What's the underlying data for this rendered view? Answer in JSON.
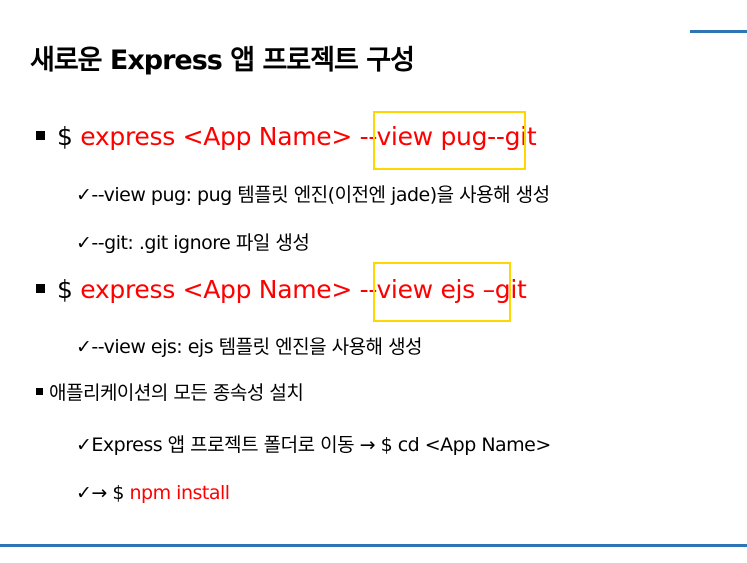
{
  "title": "새로운 Express 앱 프로젝트 구성",
  "bullets": [
    {
      "prompt": "$ ",
      "parts": [
        "express <App Name>",
        " ",
        "--view pug",
        "--git"
      ]
    },
    {
      "prompt": "$ ",
      "parts": [
        "express <App Name>",
        " ",
        "--view ejs",
        " –git"
      ]
    }
  ],
  "subs": [
    {
      "check": "✓",
      "text": "--view pug: pug 템플릿 엔진(이전엔 jade)을 사용해 생성"
    },
    {
      "check": "✓",
      "text": "--git:  .git ignore 파일 생성"
    },
    {
      "check": "✓",
      "text": "--view ejs: ejs 템플릿 엔진을 사용해 생성"
    },
    {
      "check": "✓",
      "text": "Express 앱 프로젝트 폴더로 이동 → $ cd <App Name>"
    },
    {
      "check": "✓",
      "arrow": "→ $ ",
      "cmd": "npm install"
    }
  ],
  "section3": "애플리케이션의 모든 종속성 설치",
  "colors": {
    "accent": "#ff0000",
    "highlight": "#ffd700",
    "rule": "#2e75b6"
  }
}
